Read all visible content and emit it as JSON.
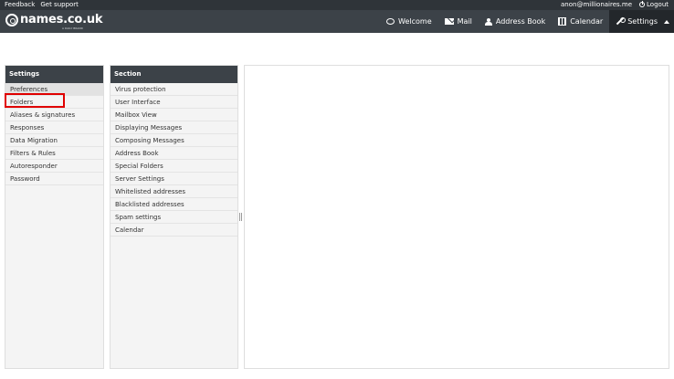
{
  "topbar": {
    "feedback": "Feedback",
    "support": "Get support",
    "user_email": "anon@millionaires.me",
    "logout": "Logout"
  },
  "logo": {
    "text": "names.co.uk",
    "subtitle": "A DAILY BRAND"
  },
  "nav": {
    "items": [
      {
        "label": "Welcome",
        "icon": "chat-icon"
      },
      {
        "label": "Mail",
        "icon": "mail-icon"
      },
      {
        "label": "Address Book",
        "icon": "contacts-icon"
      },
      {
        "label": "Calendar",
        "icon": "calendar-icon"
      },
      {
        "label": "Settings",
        "icon": "wrench-icon"
      }
    ],
    "active": "Settings"
  },
  "settings": {
    "title": "Settings",
    "items": [
      "Preferences",
      "Folders",
      "Aliases & signatures",
      "Responses",
      "Data Migration",
      "Filters & Rules",
      "Autoresponder",
      "Password"
    ],
    "selected": "Preferences",
    "highlighted": "Folders"
  },
  "section": {
    "title": "Section",
    "items": [
      "Virus protection",
      "User Interface",
      "Mailbox View",
      "Displaying Messages",
      "Composing Messages",
      "Address Book",
      "Special Folders",
      "Server Settings",
      "Whitelisted addresses",
      "Blacklisted addresses",
      "Spam settings",
      "Calendar"
    ]
  },
  "colors": {
    "topbar": "#2f3439",
    "header": "#3c4248",
    "highlight": "#e00000"
  }
}
